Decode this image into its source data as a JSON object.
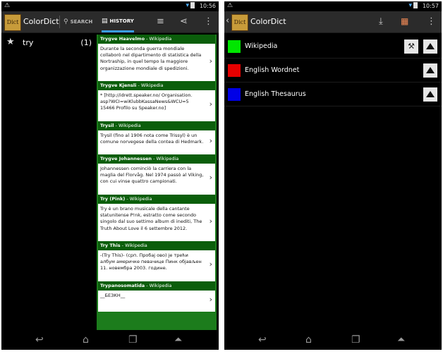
{
  "left_screen": {
    "status": {
      "time": "10:56",
      "warning_icon": "warning-icon",
      "signal_icons": "▾ ▮"
    },
    "actionbar": {
      "logo_text": "Dict",
      "title": "ColorDict",
      "search_tab": "SEARCH",
      "history_tab": "HISTORY",
      "icons": [
        "search-icon",
        "history-list-icon",
        "sort-icon",
        "share-icon",
        "overflow-menu-icon"
      ]
    },
    "history_list": [
      {
        "word": "try",
        "count": "(1)"
      }
    ],
    "entries": [
      {
        "title": "Trygve Haavelmo",
        "source": "Wikipedia",
        "body": "Durante la seconda guerra mondiale collaborò nel dipartimento di statistica della Nortraship, in quel tempo la maggiore organizzazione mondiale di spedizioni."
      },
      {
        "title": "Trygve Kjensli",
        "source": "Wikipedia",
        "body": "* [http://idrett.speaker.no/ Organisation. asp?WCI=wiKlubbKassaNews&WCU=5 15466 Profilo su Speaker.no]"
      },
      {
        "title": "Trysil",
        "source": "Wikipedia",
        "body": "Trysil (fino al 1906 nota come Trissyl) è un comune norvegese della contea di Hedmark."
      },
      {
        "title": "Trygve Johannessen",
        "source": "Wikipedia",
        "body": "Johannessen cominciò la carriera con la maglia del Florvåg. Nel 1974 passò al Viking, con cui vinse quattro campionati."
      },
      {
        "title": "Try (Pink)",
        "source": "Wikipedia",
        "body": "Try è un brano musicale della cantante statunitense P!nk, estratto come secondo singolo dal suo settimo album di inediti, The Truth About Love il 6 settembre 2012."
      },
      {
        "title": "Try This",
        "source": "Wikipedia",
        "body": "-(Try This)- (срп. Пробај ово) је трећи албум америчке певачице Пинк објављен 11. новембра 2003. године."
      },
      {
        "title": "Trypanosomatida",
        "source": "Wikipedia",
        "body": "__БЕЗКН__"
      }
    ],
    "separator": " - ",
    "chevron": "›"
  },
  "right_screen": {
    "status": {
      "time": "10:57",
      "warning_icon": "warning-icon",
      "signal_icons": "▾ ▮"
    },
    "actionbar": {
      "back_glyph": "‹",
      "logo_text": "Dict",
      "title": "ColorDict",
      "icons": [
        "download-icon",
        "cubes-icon",
        "overflow-menu-icon"
      ]
    },
    "dictionaries": [
      {
        "name": "Wikipedia",
        "color": "#00e600",
        "has_settings": true
      },
      {
        "name": "English Wordnet",
        "color": "#e60000",
        "has_settings": false
      },
      {
        "name": "English Thesaurus",
        "color": "#0000e6",
        "has_settings": false
      }
    ]
  },
  "navbar": {
    "icons": [
      "back-icon",
      "home-icon",
      "recent-apps-icon",
      "menu-up-icon"
    ]
  }
}
